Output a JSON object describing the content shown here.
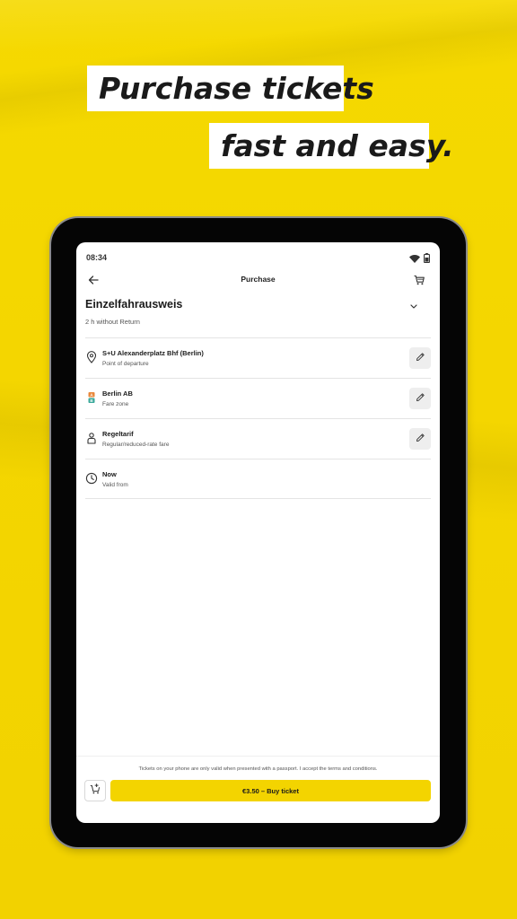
{
  "promo": {
    "line1": "Purchase tickets",
    "line2": "fast and easy."
  },
  "status_bar": {
    "time": "08:34",
    "icons": [
      "wifi-icon",
      "battery-icon"
    ]
  },
  "app_bar": {
    "title": "Purchase",
    "back_icon": "arrow-left-icon",
    "cart_icon": "cart-icon"
  },
  "ticket": {
    "name": "Einzelfahrausweis",
    "validity": "2 h without Return",
    "expand_icon": "chevron-down-icon"
  },
  "rows": [
    {
      "title": "S+U Alexanderplatz Bhf (Berlin)",
      "subtitle": "Point of departure",
      "icon": "location-pin-icon",
      "editable": true
    },
    {
      "title": "Berlin AB",
      "subtitle": "Fare zone",
      "icon": "fare-zone-icon",
      "editable": true
    },
    {
      "title": "Regeltarif",
      "subtitle": "Regular/reduced-rate fare",
      "icon": "person-icon",
      "editable": true
    },
    {
      "title": "Now",
      "subtitle": "Valid from",
      "icon": "clock-icon",
      "editable": false
    }
  ],
  "footer": {
    "note": "Tickets on your phone are only valid when presented with a passport. I accept the terms and conditions.",
    "buy_label": "€3.50 – Buy ticket",
    "add_cart_icon": "add-to-cart-icon"
  },
  "colors": {
    "brand_yellow": "#f3d400",
    "text": "#1a1a1a"
  }
}
